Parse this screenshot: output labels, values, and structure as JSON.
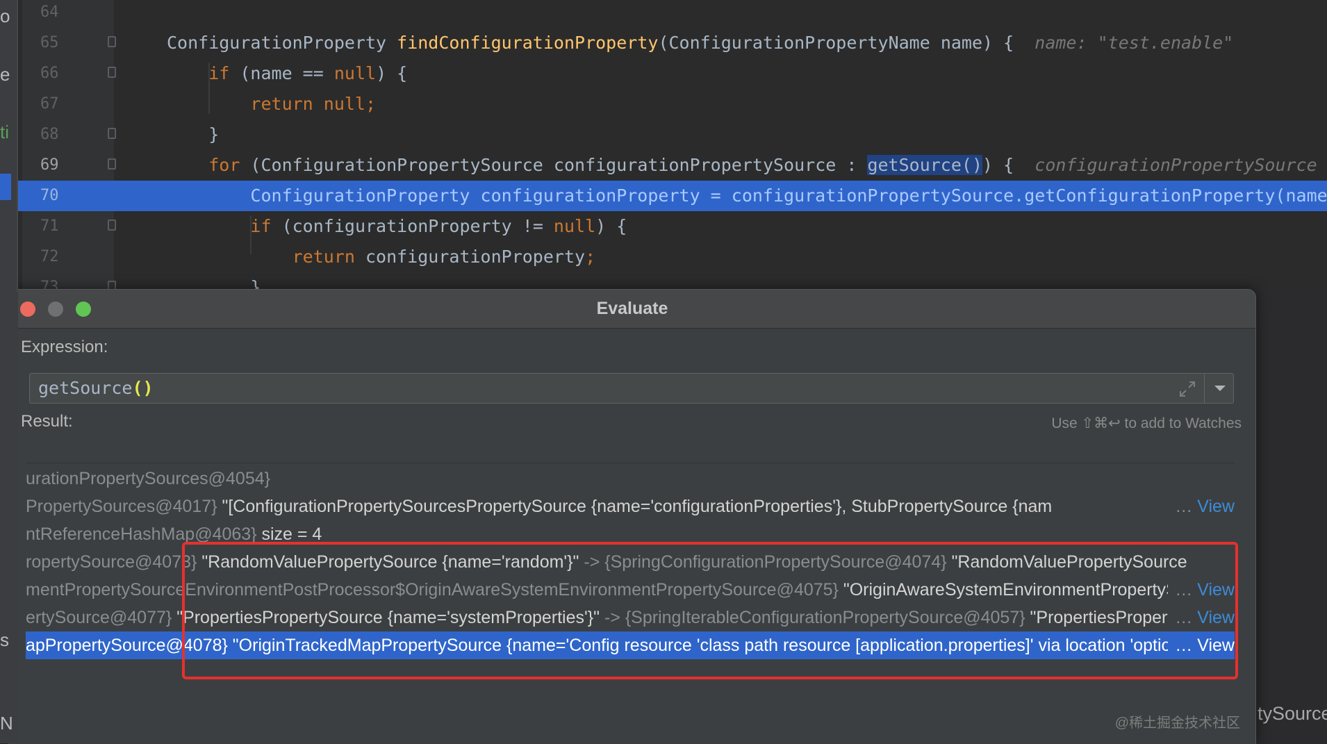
{
  "editor": {
    "left_strip_chars": [
      "o",
      "e",
      "ti",
      "s",
      "N"
    ],
    "lines": [
      {
        "no": "64",
        "parts": []
      },
      {
        "no": "65",
        "parts": [
          {
            "t": "ConfigurationProperty ",
            "c": "plain"
          },
          {
            "t": "findConfigurationProperty",
            "c": "fn"
          },
          {
            "t": "(ConfigurationPropertyName name) {  ",
            "c": "plain"
          },
          {
            "t": "name: \"test.enable\"",
            "c": "hint"
          }
        ]
      },
      {
        "no": "66",
        "parts": [
          {
            "t": "    ",
            "c": "plain"
          },
          {
            "t": "if",
            "c": "kw"
          },
          {
            "t": " (name == ",
            "c": "plain"
          },
          {
            "t": "null",
            "c": "kw"
          },
          {
            "t": ") {",
            "c": "plain"
          }
        ]
      },
      {
        "no": "67",
        "parts": [
          {
            "t": "        ",
            "c": "plain"
          },
          {
            "t": "return null;",
            "c": "kw"
          }
        ]
      },
      {
        "no": "68",
        "parts": [
          {
            "t": "    }",
            "c": "plain"
          }
        ]
      },
      {
        "no": "69",
        "parts": [
          {
            "t": "    ",
            "c": "plain"
          },
          {
            "t": "for",
            "c": "kw"
          },
          {
            "t": " (ConfigurationPropertySource configurationPropertySource : ",
            "c": "plain"
          },
          {
            "t": "getSource()",
            "c": "sel"
          },
          {
            "t": ") {  ",
            "c": "plain"
          },
          {
            "t": "configurationPropertySource",
            "c": "hint"
          }
        ]
      },
      {
        "no": "70",
        "parts": [
          {
            "t": "        ConfigurationProperty configurationProperty = configurationPropertySource.getConfigurationProperty(name);",
            "c": "plain"
          }
        ]
      },
      {
        "no": "71",
        "parts": [
          {
            "t": "        ",
            "c": "plain"
          },
          {
            "t": "if",
            "c": "kw"
          },
          {
            "t": " (configurationProperty != ",
            "c": "plain"
          },
          {
            "t": "null",
            "c": "kw"
          },
          {
            "t": ") {",
            "c": "plain"
          }
        ]
      },
      {
        "no": "72",
        "parts": [
          {
            "t": "            ",
            "c": "plain"
          },
          {
            "t": "return",
            "c": "kw"
          },
          {
            "t": " configurationProperty",
            "c": "plain"
          },
          {
            "t": ";",
            "c": "kw"
          }
        ]
      },
      {
        "no": "73",
        "parts": [
          {
            "t": "        }",
            "c": "plain"
          }
        ]
      }
    ]
  },
  "dialog": {
    "title": "Evaluate",
    "expression_label": "Expression:",
    "expression_name": "getSource",
    "expression_parens": "()",
    "watch_hint": "Use ⇧⌘↩ to add to Watches",
    "result_label": "Result:",
    "results": [
      {
        "parts": [
          {
            "t": "urationPropertySources@4054}",
            "c": "cg"
          }
        ]
      },
      {
        "parts": [
          {
            "t": "PropertySources@4017} ",
            "c": "cg"
          },
          {
            "t": "\"[ConfigurationPropertySourcesPropertySource {name='configurationProperties'}, StubPropertySource {nam",
            "c": "cw"
          }
        ],
        "view": "View"
      },
      {
        "parts": [
          {
            "t": "ntReferenceHashMap@4063} ",
            "c": "cg"
          },
          {
            "t": " size = 4",
            "c": "cw"
          }
        ]
      },
      {
        "parts": [
          {
            "t": "ropertySource@4073} ",
            "c": "cg"
          },
          {
            "t": "\"RandomValuePropertySource {name='random'}\"",
            "c": "cw"
          },
          {
            "t": " -> {SpringConfigurationPropertySource@4074} ",
            "c": "cg"
          },
          {
            "t": "\"RandomValuePropertySource",
            "c": "cw"
          }
        ]
      },
      {
        "parts": [
          {
            "t": "mentPropertySourceEnvironmentPostProcessor$OriginAwareSystemEnvironmentPropertySource@4075} ",
            "c": "cg"
          },
          {
            "t": "\"OriginAwareSystemEnvironmentPropertySource",
            "c": "cw"
          }
        ],
        "view": "View"
      },
      {
        "parts": [
          {
            "t": "ertySource@4077} ",
            "c": "cg"
          },
          {
            "t": "\"PropertiesPropertySource {name='systemProperties'}\"",
            "c": "cw"
          },
          {
            "t": " -> {SpringIterableConfigurationPropertySource@4057} ",
            "c": "cg"
          },
          {
            "t": "\"PropertiesPropertySource",
            "c": "cw"
          }
        ],
        "view": "View"
      },
      {
        "parts": [
          {
            "t": "apPropertySource@4078} ",
            "c": "cw"
          },
          {
            "t": "\"OriginTrackedMapPropertySource {name='Config resource 'class path resource [application.properties]' via location 'optional:classpath:/'}\"",
            "c": "cw"
          }
        ],
        "view": "View",
        "selected": true
      }
    ],
    "watermark": "@稀土掘金技术社区"
  },
  "right_strip_text": "tySource"
}
